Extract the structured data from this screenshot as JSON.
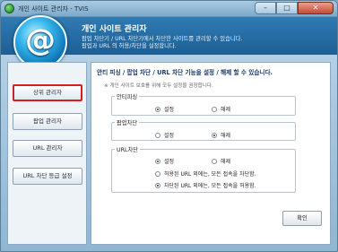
{
  "window": {
    "title": "개인 사이트 관리자 - TVIS",
    "minimize": "–",
    "maximize": "□",
    "close": "✕"
  },
  "header": {
    "logo_glyph": "@",
    "title": "개인 사이트 관리자",
    "subtitle_line1": "팝업 차단기 / URL 차단기에서 차단한 사이트를 관리할 수 있습니다.",
    "subtitle_line2": "팝업과 URL 의 허용/차단을 설정합니다."
  },
  "sidebar": {
    "items": [
      {
        "label": "상위 관리자"
      },
      {
        "label": "팝업 관리자"
      },
      {
        "label": "URL 관리자"
      },
      {
        "label": "URL 차단 등급 설정"
      }
    ]
  },
  "content": {
    "heading": "안티 피싱 / 팝업 차단 / URL 차단 기능을 설정 / 해제 할 수 있습니다.",
    "note": "※ 개인 사이트 보호를 위해 모두 설정을 권장합니다.",
    "groups": {
      "anti_phishing": {
        "label": "안티피싱",
        "on": "설정",
        "off": "해제"
      },
      "popup": {
        "label": "팝업차단",
        "on": "설정",
        "off": "해제"
      },
      "url": {
        "label": "URL차단",
        "on": "설정",
        "off": "해제",
        "opt1": "허용된 URL 외에는, 모든 접속을 차단함.",
        "opt2": "차단된 URL 외에는, 모든 접속을 허용함."
      }
    },
    "ok_button": "확인"
  }
}
